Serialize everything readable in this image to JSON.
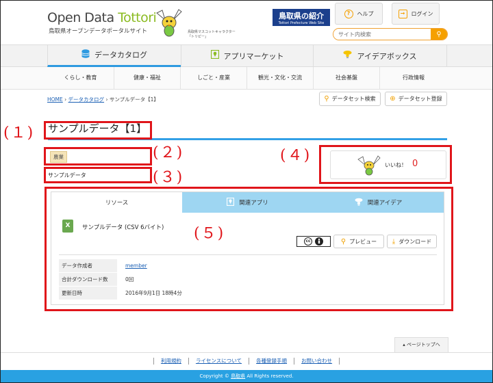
{
  "header": {
    "logo_part1": "Open Data ",
    "logo_part2": "Tottori",
    "logo_sub": "鳥取県オープンデータポータルサイト",
    "mascot_caption_1": "鳥取県マスコットキャラクター",
    "mascot_caption_2": "「トリピー」",
    "pref_button_title": "鳥取県の紹介",
    "pref_button_sub": "Tottori Prefecture Web Site",
    "help_label": "ヘルプ",
    "login_label": "ログイン",
    "search_placeholder": "サイト内検索"
  },
  "main_nav": [
    {
      "label": "データカタログ",
      "icon": "database-icon"
    },
    {
      "label": "アプリマーケット",
      "icon": "map-pin-icon"
    },
    {
      "label": "アイデアボックス",
      "icon": "lightbulb-icon"
    }
  ],
  "sub_nav": [
    "くらし・教育",
    "健康・福祉",
    "しごと・産業",
    "観光・文化・交流",
    "社会基盤",
    "行政情報"
  ],
  "breadcrumb": {
    "home": "HOME",
    "sep1": "›",
    "catalog": "データカタログ",
    "sep2": "›",
    "current": "サンプルデータ【1】"
  },
  "toolbar": {
    "search_dataset": "データセット検索",
    "register_dataset": "データセット登録"
  },
  "dataset": {
    "title": "サンプルデータ【1】",
    "tag": "農業",
    "description": "サンプルデータ",
    "like_label": "いいね！",
    "like_count": "0"
  },
  "tabs": [
    "リソース",
    "関連アプリ",
    "関連アイデア"
  ],
  "resource": {
    "name": "サンプルデータ (CSV 6バイト)",
    "license": "cc",
    "preview_label": "プレビュー",
    "download_label": "ダウンロード",
    "meta": [
      {
        "key": "データ作成者",
        "value": "member"
      },
      {
        "key": "合計ダウンロード数",
        "value": "0回"
      },
      {
        "key": "更新日時",
        "value": "2016年9月1日 18時4分"
      }
    ]
  },
  "annotations": [
    "(１)",
    "(２)",
    "(３)",
    "(４)",
    "(５)"
  ],
  "footer": {
    "page_top": "ページトップへ",
    "links": [
      "利用規約",
      "ライセンスについて",
      "各種登録手順",
      "お問い合わせ"
    ],
    "copyright_pre": "Copyright © ",
    "copyright_owner": "鳥取県",
    "copyright_post": " All Rights reserved."
  },
  "colors": {
    "accent_blue": "#2e9ae0",
    "accent_orange": "#f5a000",
    "annotation_red": "#e0151a",
    "tab_blue": "#9ed6f2"
  }
}
